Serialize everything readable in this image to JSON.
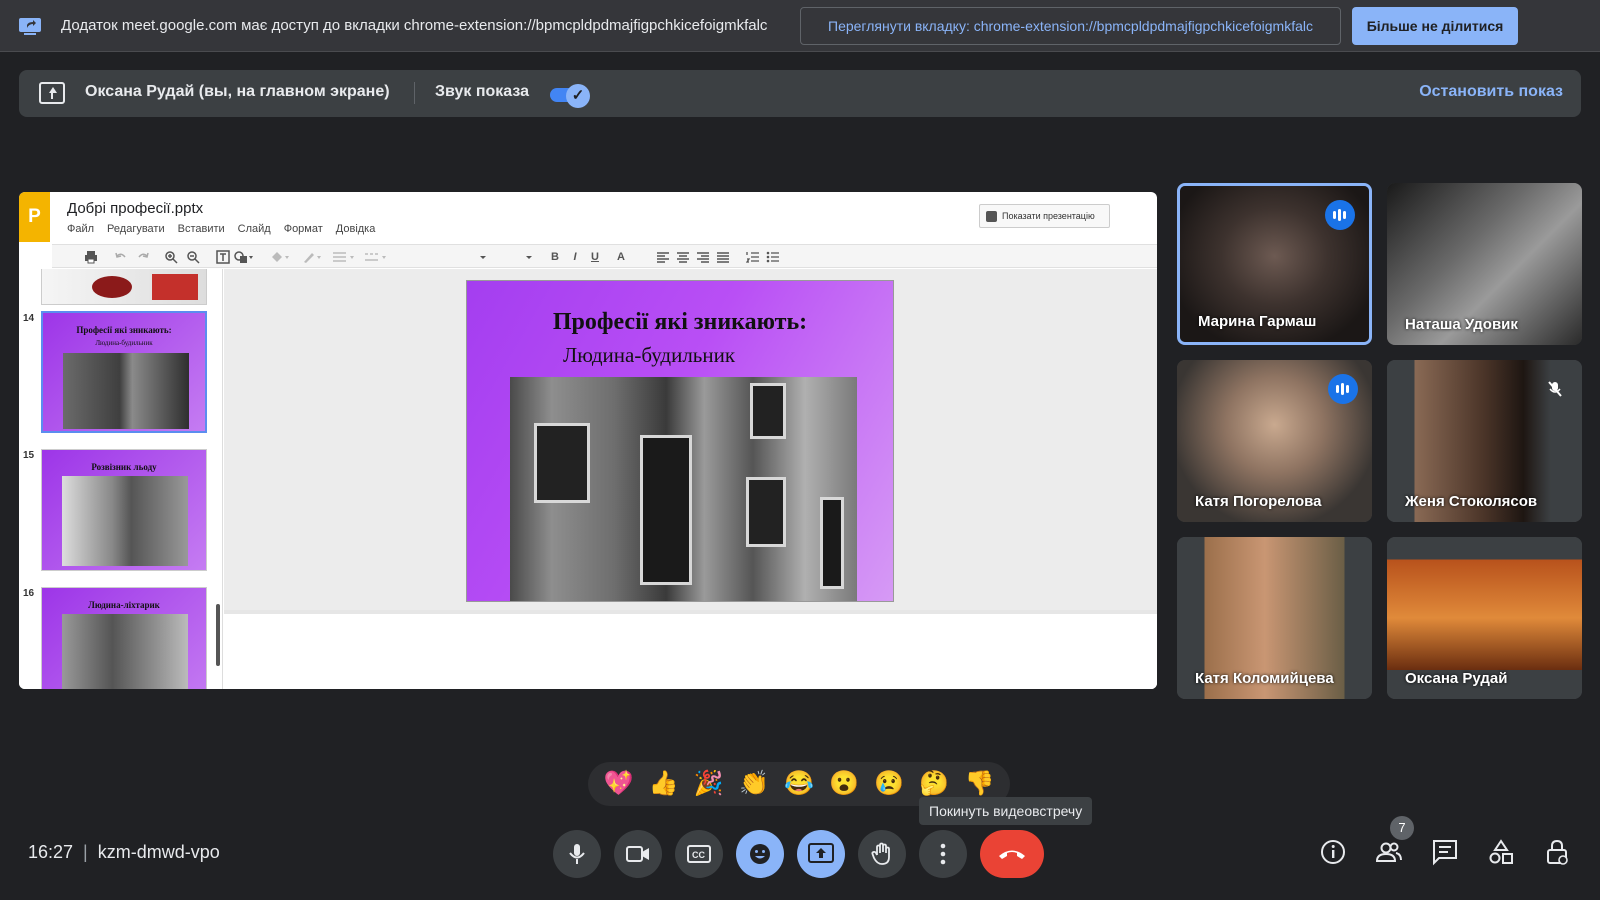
{
  "infobar": {
    "message": "Додаток meet.google.com має доступ до вкладки chrome-extension://bpmcpldpdmajfigpchkicefoigmkfalc",
    "view_tab_label": "Переглянути вкладку: chrome-extension://bpmcpldpdmajfigpchkicefoigmkfalc",
    "stop_sharing_label": "Більше не ділитися",
    "cast_icon": "screen-share-icon"
  },
  "presenting_bar": {
    "presenter_label": "Оксана Рудай (вы, на главном экране)",
    "sound_label": "Звук показа",
    "sound_enabled": true,
    "stop_label": "Остановить показ"
  },
  "presentation": {
    "logo_letter": "P",
    "doc_title": "Добрі професії.pptx",
    "menu": [
      "Файл",
      "Редагувати",
      "Вставити",
      "Слайд",
      "Формат",
      "Довідка"
    ],
    "show_button": "Показати презентацію",
    "toolbar": [
      "B",
      "I",
      "U",
      "A"
    ],
    "thumbnails": [
      {
        "number": "14",
        "title": "Професії які зникають:",
        "subtitle": "Людина-будильник"
      },
      {
        "number": "15",
        "title": "Розвізник льоду",
        "subtitle": ""
      },
      {
        "number": "16",
        "title": "Людина-ліхтарик",
        "subtitle": ""
      }
    ],
    "slide": {
      "title": "Професії які зникають:",
      "subtitle": "Людина-будильник"
    }
  },
  "participants": [
    {
      "name": "Марина Гармаш",
      "status": "speaking"
    },
    {
      "name": "Наташа Удовик",
      "status": "none"
    },
    {
      "name": "Катя Погорелова",
      "status": "speaking"
    },
    {
      "name": "Женя Стоколясов",
      "status": "muted"
    },
    {
      "name": "Катя Коломийцева",
      "status": "none"
    },
    {
      "name": "Оксана Рудай",
      "status": "none"
    }
  ],
  "reactions": [
    "💖",
    "👍",
    "🎉",
    "👏",
    "😂",
    "😮",
    "😢",
    "🤔",
    "👎"
  ],
  "tooltip": "Покинуть видеовстречу",
  "meeting": {
    "time": "16:27",
    "separator": "|",
    "code": "kzm-dmwd-vpo"
  },
  "controls": [
    "microphone-icon",
    "camera-icon",
    "captions-icon",
    "emoji-icon",
    "present-icon",
    "raise-hand-icon",
    "more-options-icon",
    "end-call-icon"
  ],
  "right_controls": {
    "participant_count": "7",
    "icons": [
      "info-icon",
      "people-icon",
      "chat-icon",
      "activities-icon",
      "host-controls-icon"
    ]
  }
}
